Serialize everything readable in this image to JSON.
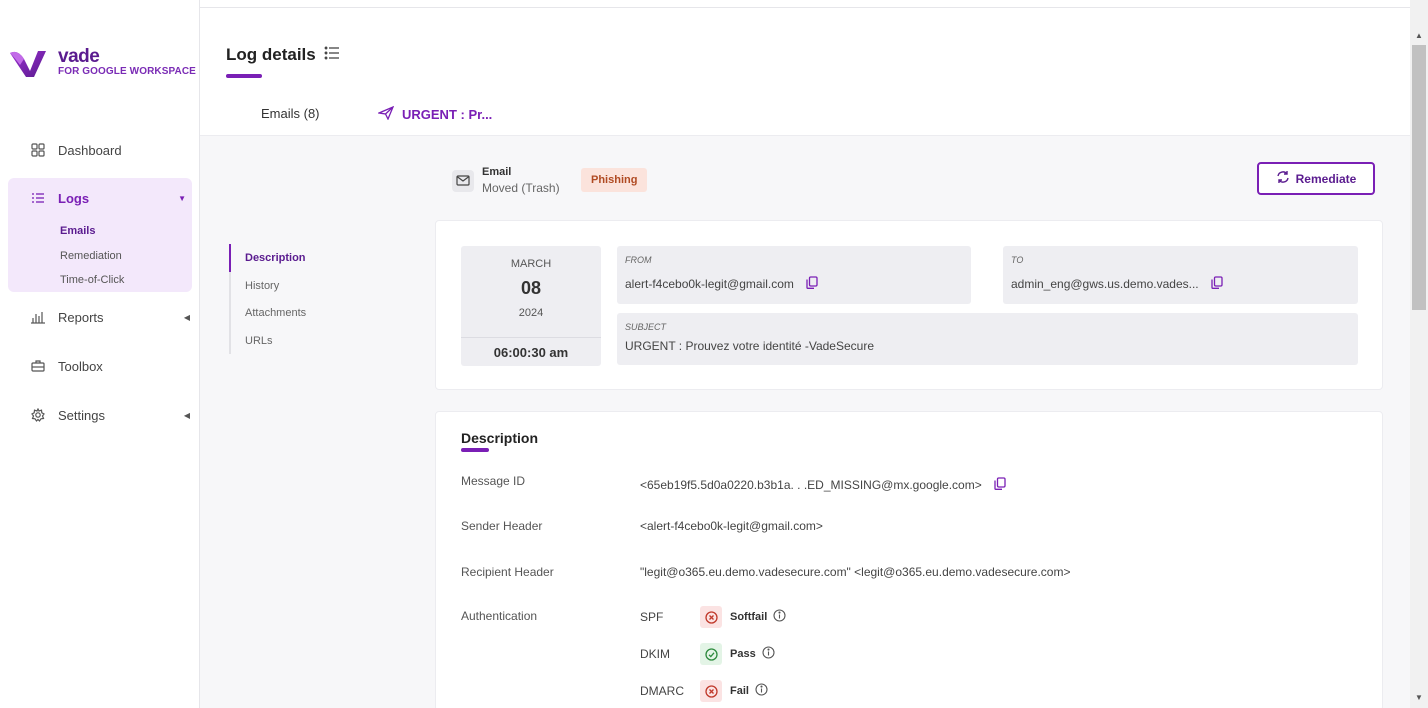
{
  "brand": {
    "name": "vade",
    "subtitle": "FOR GOOGLE WORKSPACE",
    "accent": "#7a1fb5"
  },
  "sidebar": {
    "dashboard": "Dashboard",
    "logs": "Logs",
    "logs_sub": [
      "Emails",
      "Remediation",
      "Time-of-Click"
    ],
    "reports": "Reports",
    "toolbox": "Toolbox",
    "settings": "Settings"
  },
  "header": {
    "title": "Log details",
    "tab_emails": "Emails (8)",
    "tab_urgent": "URGENT : Pr..."
  },
  "side_tabs": [
    "Description",
    "History",
    "Attachments",
    "URLs"
  ],
  "email_status": {
    "label": "Email",
    "status": "Moved (Trash)",
    "badge": "Phishing"
  },
  "remediate_label": "Remediate",
  "summary": {
    "month": "MARCH",
    "day": "08",
    "year": "2024",
    "time": "06:00:30 am",
    "from_label": "FROM",
    "from_value": "alert-f4cebo0k-legit@gmail.com",
    "to_label": "TO",
    "to_value": "admin_eng@gws.us.demo.vades...",
    "subject_label": "SUBJECT",
    "subject_value": "URGENT : Prouvez votre identité -VadeSecure"
  },
  "description": {
    "title": "Description",
    "message_id_label": "Message ID",
    "message_id_value": "<65eb19f5.5d0a0220.b3b1a. . .ED_MISSING@mx.google.com>",
    "sender_label": "Sender Header",
    "sender_value": "<alert-f4cebo0k-legit@gmail.com>",
    "recipient_label": "Recipient Header",
    "recipient_value": "\"legit@o365.eu.demo.vadesecure.com\" <legit@o365.eu.demo.vadesecure.com>",
    "auth_label": "Authentication",
    "auth": [
      {
        "name": "SPF",
        "result": "Softfail",
        "status": "fail"
      },
      {
        "name": "DKIM",
        "result": "Pass",
        "status": "pass"
      },
      {
        "name": "DMARC",
        "result": "Fail",
        "status": "fail"
      }
    ]
  }
}
